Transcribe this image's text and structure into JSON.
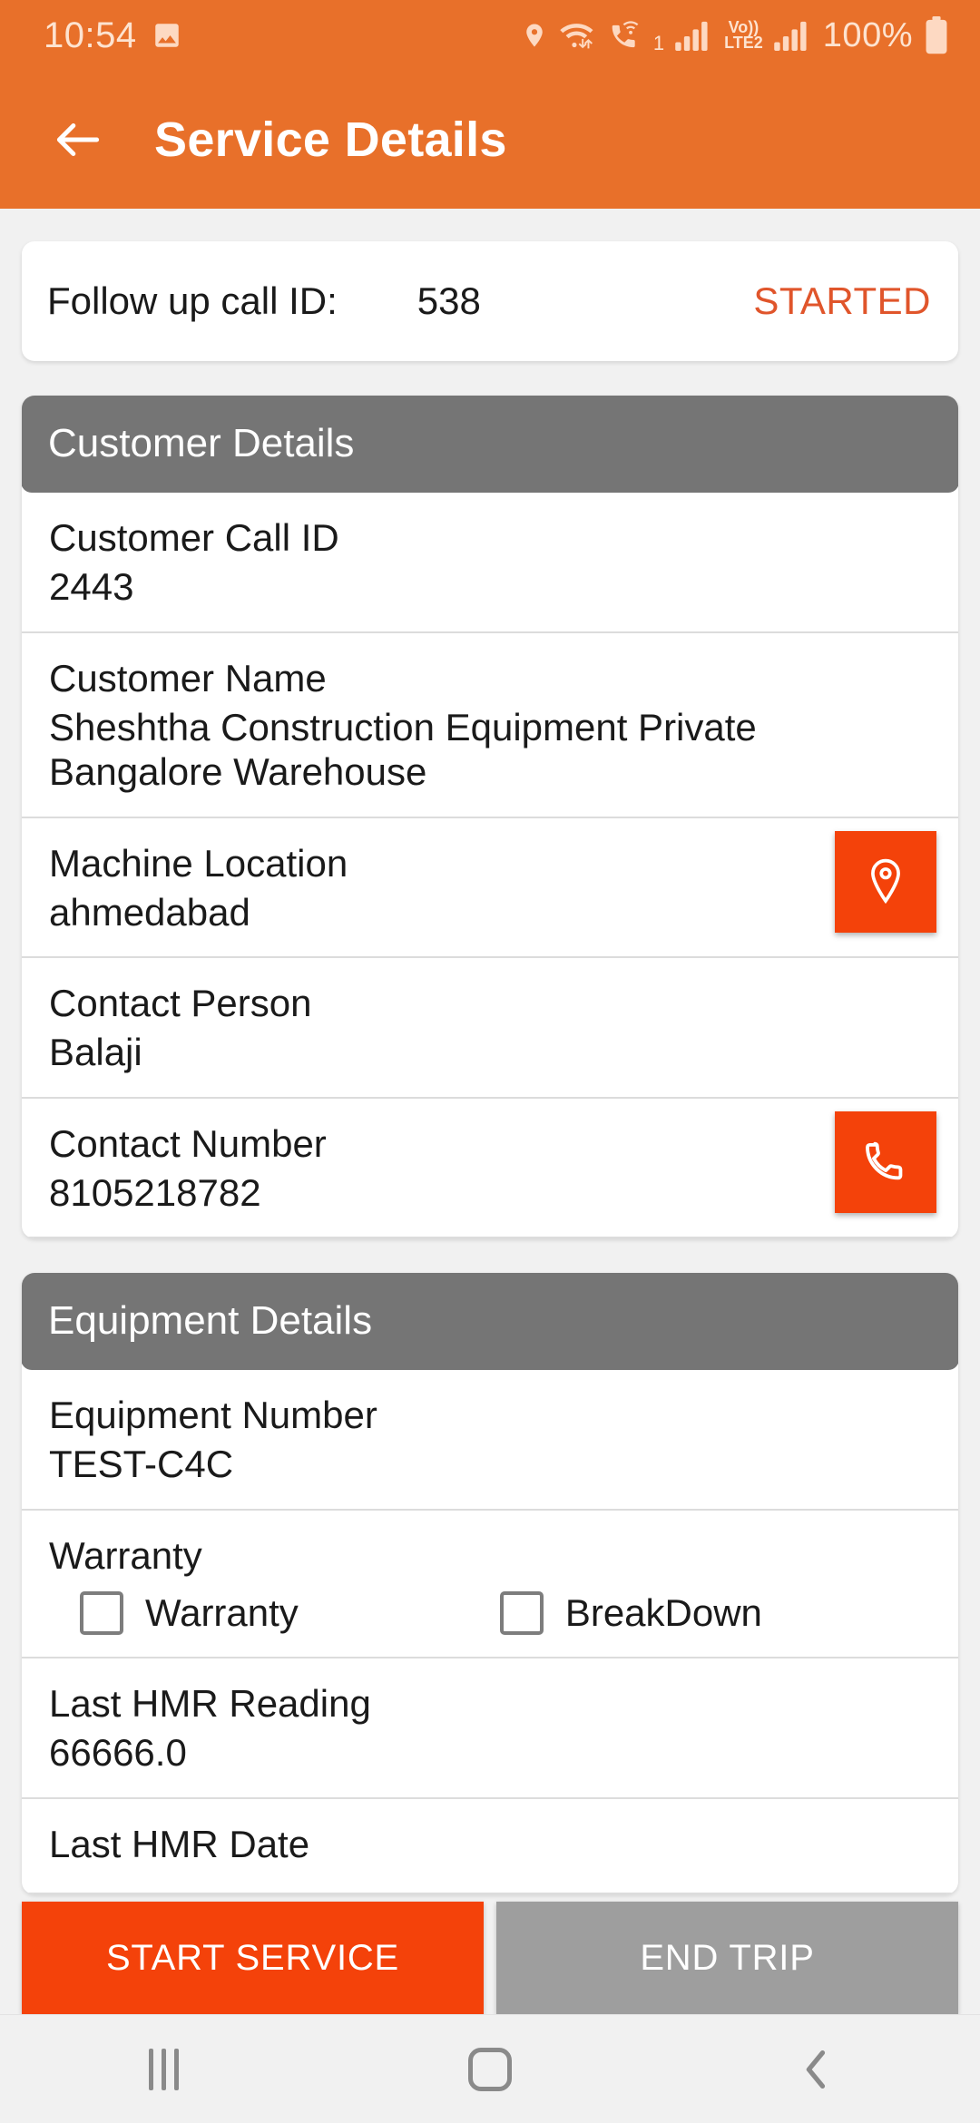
{
  "statusbar": {
    "time": "10:54",
    "icons_left": [
      "image-icon"
    ],
    "icons_right": [
      "location-pin-icon",
      "wifi-icon",
      "wifi-calling-icon",
      "signal-bars-icon",
      "volte-icon",
      "signal-bars-icon"
    ],
    "volte_top": "Vo))",
    "volte_bottom": "LTE2",
    "sim_number": "1",
    "battery_text": "100%"
  },
  "appbar": {
    "back_icon": "arrow-left-icon",
    "title": "Service Details"
  },
  "status_card": {
    "label": "Follow up call ID:",
    "value": "538",
    "status": "STARTED",
    "status_color": "#E0552B"
  },
  "customer_section": {
    "header": "Customer Details",
    "rows": [
      {
        "label": "Customer Call ID",
        "value": "2443",
        "action": null
      },
      {
        "label": "Customer Name",
        "value": "Sheshtha Construction Equipment Private Bangalore Warehouse",
        "action": null
      },
      {
        "label": "Machine Location",
        "value": "ahmedabad",
        "action": "map-pin-icon"
      },
      {
        "label": "Contact Person",
        "value": "Balaji",
        "action": null
      },
      {
        "label": "Contact Number",
        "value": "8105218782",
        "action": "phone-icon"
      }
    ]
  },
  "equipment_section": {
    "header": "Equipment Details",
    "equipment_number_label": "Equipment Number",
    "equipment_number_value": "TEST-C4C",
    "warranty_label": "Warranty",
    "checkboxes": [
      {
        "label": "Warranty",
        "checked": false
      },
      {
        "label": "BreakDown",
        "checked": false
      }
    ],
    "hmr_reading_label": "Last HMR Reading",
    "hmr_reading_value": "66666.0",
    "hmr_date_label": "Last HMR Date"
  },
  "bottom": {
    "primary_label": "START SERVICE",
    "secondary_label": "END TRIP",
    "primary_color": "#F4420A",
    "secondary_color": "#9E9E9E"
  },
  "navbar": {
    "recents": "recents-icon",
    "home": "home-icon",
    "back": "back-icon"
  },
  "theme": {
    "appbar_color": "#E8702A",
    "accent_color": "#F4420A",
    "section_header_color": "#757575",
    "background": "#F1F1F1"
  }
}
